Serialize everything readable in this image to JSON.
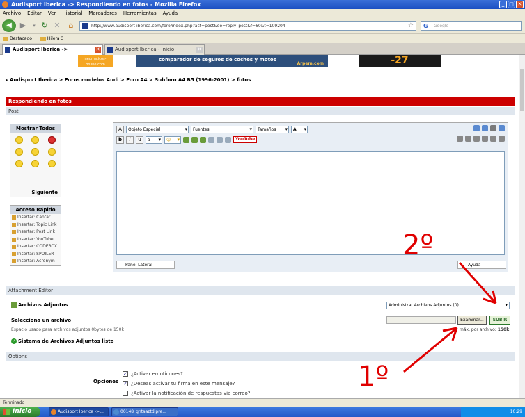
{
  "window": {
    "title": "Audisport Iberica -> Respondiendo en fotos - Mozilla Firefox"
  },
  "menu": [
    "Archivo",
    "Editar",
    "Ver",
    "Historial",
    "Marcadores",
    "Herramientas",
    "Ayuda"
  ],
  "nav": {
    "url": "http://www.audisport-iberica.com/foro/index.php?act=post&do=reply_post&f=60&t=109204",
    "search_placeholder": "Google"
  },
  "bookmarks": [
    "Destacado",
    "Hilera 3"
  ],
  "tabs": [
    {
      "label": "Audisport Iberica -> Respondien..."
    },
    {
      "label": "Audisport Iberica - Inicio"
    }
  ],
  "banners": {
    "neumaticos": "neumaticos-online.com",
    "arpem": "comparador de seguros de coches y motos",
    "arpem_brand": "Arpem.com"
  },
  "breadcrumb": "▸ Audisport Iberica > Foros modelos Audi > Foro A4 > Subforo A4 B5 (1996-2001) > fotos",
  "page": {
    "header": "Respondiendo en fotos",
    "subheader": "Post"
  },
  "smilies": {
    "title": "Mostrar Todos",
    "next": "Siguiente"
  },
  "quick_access": {
    "title": "Acceso Rápido",
    "items": [
      "Insertar: Cantar",
      "Insertar: Topic Link",
      "Insertar: Post Link",
      "Insertar: YouTube",
      "Insertar: CODEBOX",
      "Insertar: SPOILER",
      "Insertar: Acronym"
    ]
  },
  "editor": {
    "special_object": "Objeto Especial",
    "fonts": "Fuentes",
    "size": "Tamaños",
    "youtube": "YouTube",
    "panel_lateral": "Panel Lateral",
    "ayuda": "Ayuda"
  },
  "attachments": {
    "header": "Attachment Editor",
    "title": "Archivos Adjuntos",
    "admin_select": "Administrar Archivos Adjuntos (0)",
    "select_file": "Selecciona un archivo",
    "examinar": "Examinar...",
    "subir": "SUBIR",
    "space_used": "Espacio usado para archivos adjuntos 0bytes de 150k",
    "max_label": "máx. por archivo:",
    "max_value": "150k",
    "system": "Sistema de Archivos Adjuntos listo"
  },
  "options": {
    "header": "Options",
    "label": "Opciones",
    "items": [
      {
        "label": "¿Activar emoticones?",
        "checked": true
      },
      {
        "label": "¿Deseas activar tu firma en este mensaje?",
        "checked": true
      },
      {
        "label": "¿Activar la notificación de respuestas via correo?",
        "checked": false
      }
    ]
  },
  "annotations": {
    "first": "1º",
    "second": "2º",
    "color": "#e00000"
  },
  "statusbar": "Terminado",
  "taskbar": {
    "start": "Inicio",
    "items": [
      "Audisport Iberica ->...",
      "00148_ghtaaztdjpre..."
    ],
    "clock": "10:29"
  }
}
